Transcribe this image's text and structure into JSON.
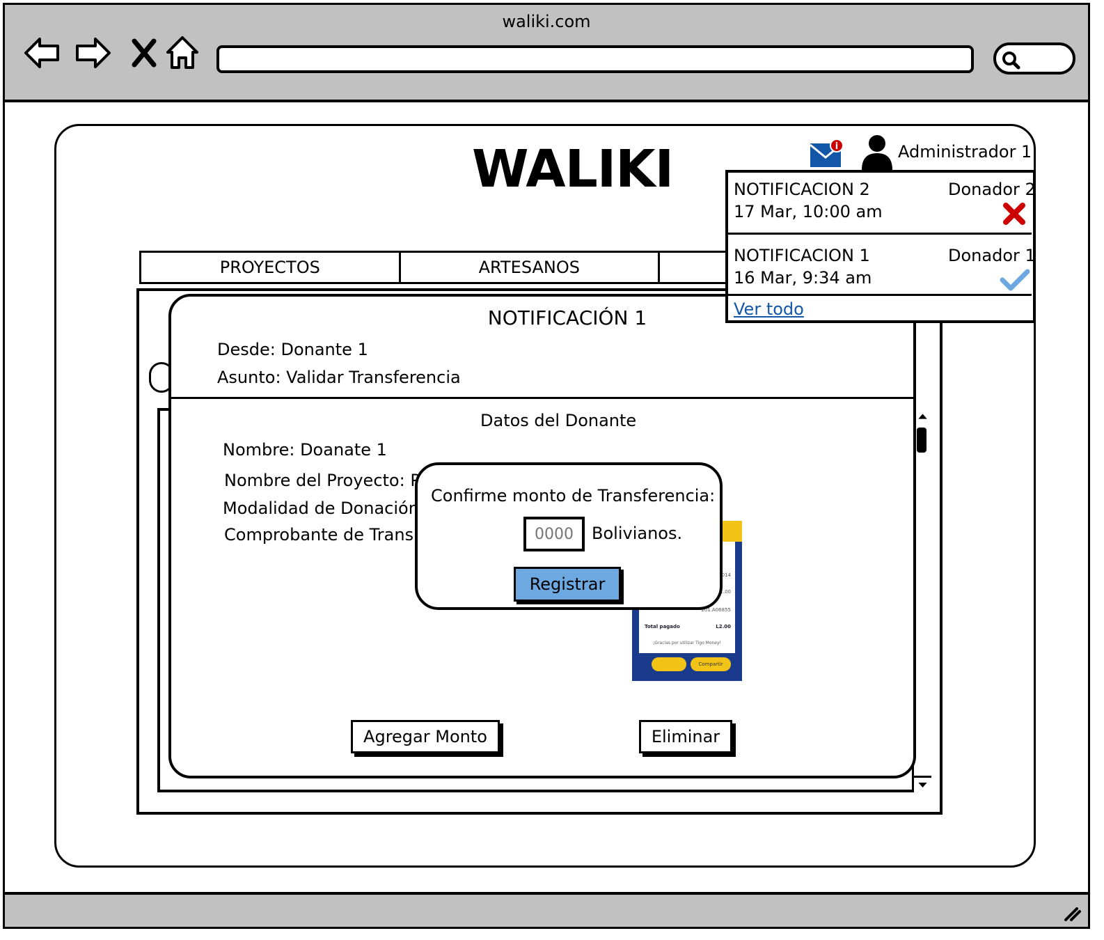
{
  "browser": {
    "url": "waliki.com"
  },
  "header": {
    "logo": "WALIKI",
    "user_name": "Administrador 1"
  },
  "nav": {
    "tabs": [
      "PROYECTOS",
      "ARTESANOS",
      ""
    ]
  },
  "notifications": {
    "items": [
      {
        "title": "NOTIFICACION 2",
        "date": "17 Mar, 10:00 am",
        "from": "Donador 2",
        "status_icon": "red-x-icon",
        "status_color": "#cc0000"
      },
      {
        "title": "NOTIFICACION 1",
        "date": "16 Mar, 9:34 am",
        "from": "Donador 1",
        "status_icon": "check-icon",
        "status_color": "#6ea8e0"
      }
    ],
    "view_all": "Ver todo"
  },
  "notification_detail": {
    "title": "NOTIFICACIÓN 1",
    "from": "Desde: Donante 1",
    "subject": "Asunto: Validar Transferencia",
    "section_title": "Datos del Donante",
    "name": "Nombre: Doanate 1",
    "project": "Nombre del Proyecto: P",
    "modality": "Modalidad de Donación",
    "receipt": "Comprobante de Trans",
    "add_amount_label": "Agregar Monto",
    "delete_label": "Eliminar"
  },
  "receipt_image": {
    "lines": [
      "014",
      "1.00",
      "201.A06855"
    ],
    "total_label": "Total pagado",
    "total_value": "L2.00",
    "thanks": "¡Gracias por utilizar Tigo Money!",
    "share": "Compartir"
  },
  "confirm_dialog": {
    "prompt": "Confirme monto de Transferencia:",
    "amount_placeholder": "0000",
    "currency": "Bolivianos.",
    "register_label": "Registrar"
  },
  "colors": {
    "chrome_gray": "#c1c1c1",
    "accent_blue": "#6ea8e0",
    "link_blue": "#1256a8",
    "mail_blue": "#1256a8",
    "badge_red": "#cc0000"
  }
}
